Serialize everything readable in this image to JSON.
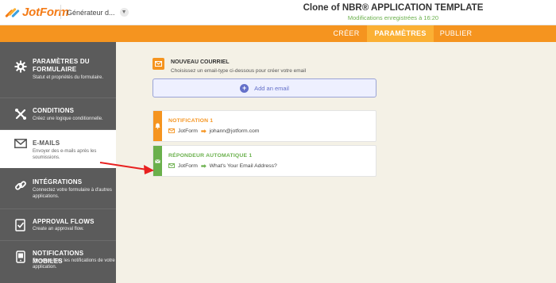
{
  "header": {
    "brand": "JotForm",
    "form_picker_label": "Générateur d...",
    "form_title": "Clone of NBR® APPLICATION TEMPLATE",
    "saved_status": "Modifications enregistrées à 16:20"
  },
  "nav": {
    "tabs": [
      {
        "label": "CRÉER",
        "active": false
      },
      {
        "label": "PARAMÈTRES",
        "active": true
      },
      {
        "label": "PUBLIER",
        "active": false
      }
    ]
  },
  "sidebar": {
    "items": [
      {
        "title": "PARAMÈTRES DU FORMULAIRE",
        "desc": "Statut et propriétés du formulaire.",
        "icon": "gear-icon",
        "active": false
      },
      {
        "title": "CONDITIONS",
        "desc": "Créez une logique conditionnelle.",
        "icon": "conditions-icon",
        "active": false
      },
      {
        "title": "E-MAILS",
        "desc": "Envoyer des e-mails après les soumissions.",
        "icon": "envelope-icon",
        "active": true
      },
      {
        "title": "INTÉGRATIONS",
        "desc": "Connectez votre formulaire à d'autres applications.",
        "icon": "link-icon",
        "active": false
      },
      {
        "title": "APPROVAL FLOWS",
        "desc": "Create an approval flow.",
        "icon": "approval-icon",
        "active": false
      },
      {
        "title": "NOTIFICATIONS MOBILES",
        "desc": "Personnalisez les notifications de votre application.",
        "icon": "mobile-icon",
        "active": false
      }
    ]
  },
  "main": {
    "new_email": {
      "title": "NOUVEAU COURRIEL",
      "subtitle": "Choisissez un email-type ci-dessous pour créer votre email",
      "add_label": "Add an email"
    },
    "emails": [
      {
        "title": "NOTIFICATION 1",
        "from": "JotForm",
        "to": "johann@jotform.com",
        "color": "#f5941f",
        "icon": "bell-icon"
      },
      {
        "title": "RÉPONDEUR AUTOMATIQUE 1",
        "from": "JotForm",
        "to": "What's Your Email Address?",
        "color": "#6ab04c",
        "icon": "envelope-icon"
      }
    ]
  },
  "colors": {
    "brand_orange": "#f5941f",
    "active_tab": "#fbb034",
    "sidebar_bg": "#5b5b5b",
    "autoresponder_green": "#6ab04c",
    "accent_blue": "#6470c9",
    "annotation_red": "#e8201f"
  }
}
